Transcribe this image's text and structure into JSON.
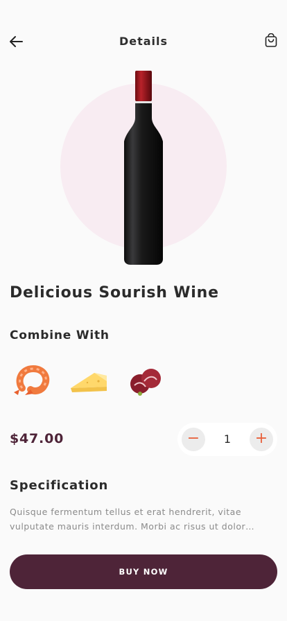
{
  "header": {
    "title": "Details",
    "back_icon": "arrow-left-icon",
    "cart_icon": "shopping-bag-icon"
  },
  "product": {
    "name": "Delicious Sourish Wine",
    "price": "$47.00",
    "image": "wine-bottle"
  },
  "combine": {
    "title": "Combine With",
    "items": [
      {
        "name": "shrimp"
      },
      {
        "name": "cheese"
      },
      {
        "name": "meat"
      }
    ]
  },
  "quantity": {
    "value": "1",
    "minus_label": "−",
    "plus_label": "+"
  },
  "specification": {
    "title": "Specification",
    "text": "Quisque fermentum tellus et erat hendrerit, vitae vulputate mauris interdum. Morbi ac risus ut dolor…"
  },
  "actions": {
    "buy_label": "BUY NOW"
  },
  "colors": {
    "accent": "#4e2438",
    "stepper_icon": "#e8613c",
    "hero_circle": "#f8ecf2",
    "background": "#fafafa"
  }
}
